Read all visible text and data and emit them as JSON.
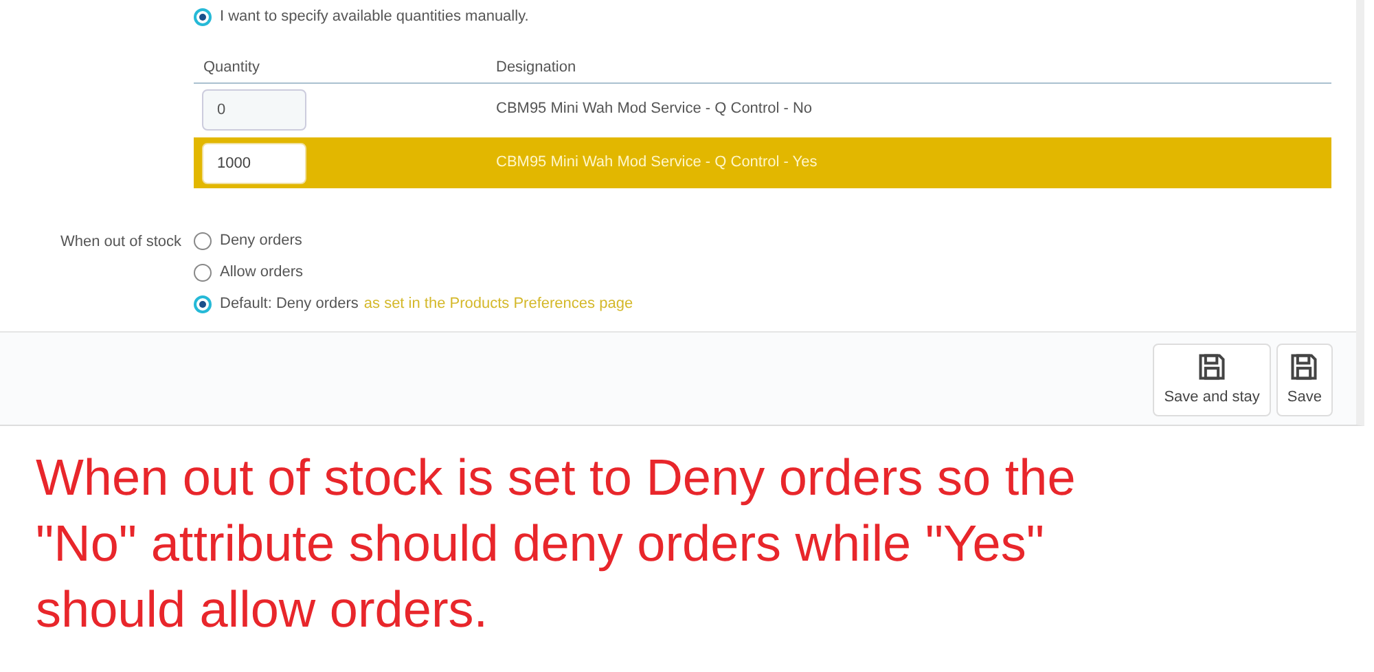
{
  "quantity_mode": {
    "label": "I want to specify available quantities manually.",
    "selected": true
  },
  "table": {
    "columns": [
      "Quantity",
      "Designation"
    ],
    "rows": [
      {
        "quantity": "0",
        "designation": "CBM95 Mini Wah Mod Service - Q Control - No",
        "selected": false
      },
      {
        "quantity": "1000",
        "designation": "CBM95 Mini Wah Mod Service - Q Control - Yes",
        "selected": true
      }
    ]
  },
  "out_of_stock": {
    "label": "When out of stock",
    "options": [
      {
        "label": "Deny orders",
        "selected": false
      },
      {
        "label": "Allow orders",
        "selected": false
      },
      {
        "label": "Default: Deny orders",
        "link": "as set in the Products Preferences page",
        "selected": true
      }
    ]
  },
  "buttons": [
    {
      "label": "Save and stay"
    },
    {
      "label": "Save"
    }
  ],
  "annotation": {
    "lines": [
      "When out of stock is set to Deny orders so the",
      "\"No\" attribute should deny orders while \"Yes\"",
      "should allow orders."
    ]
  }
}
